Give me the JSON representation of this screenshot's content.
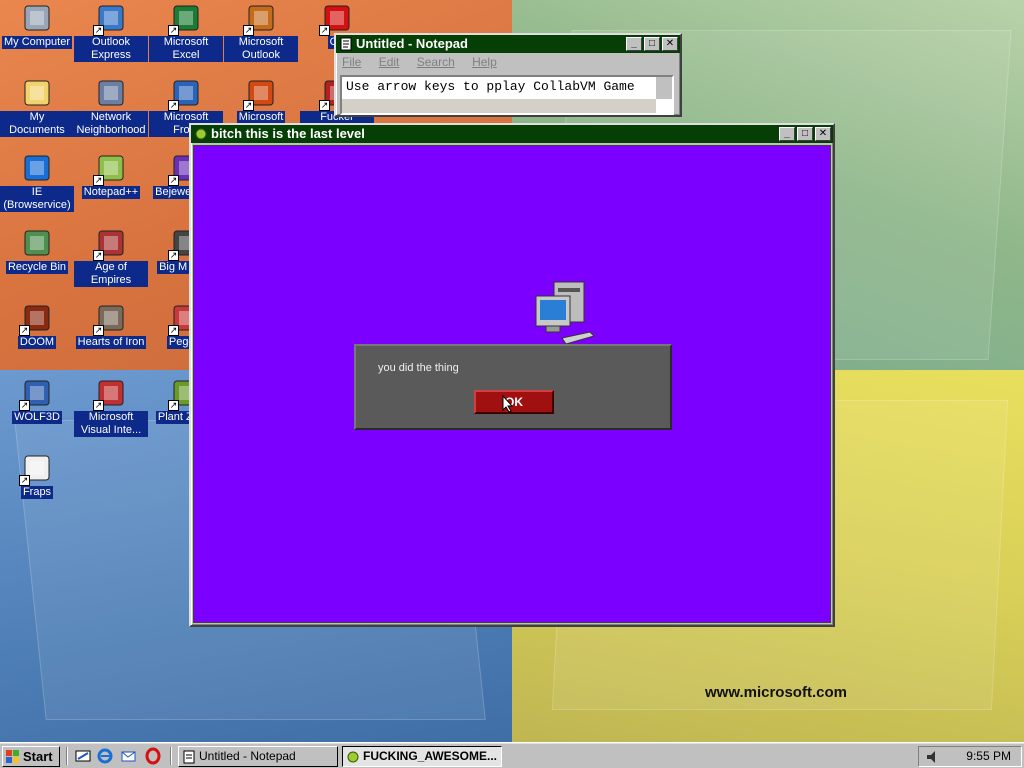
{
  "desktop": {
    "icons": [
      {
        "label": "My Computer",
        "glyph": "computer-icon"
      },
      {
        "label": "Outlook Express",
        "glyph": "outlook-express-icon"
      },
      {
        "label": "Microsoft Excel",
        "glyph": "excel-icon"
      },
      {
        "label": "Microsoft Outlook",
        "glyph": "outlook-icon"
      },
      {
        "label": "Op",
        "glyph": "opera-icon"
      },
      {
        "label": "My Documents",
        "glyph": "documents-folder-icon"
      },
      {
        "label": "Network Neighborhood",
        "glyph": "network-icon"
      },
      {
        "label": "Microsoft Front",
        "glyph": "frontpage-icon"
      },
      {
        "label": "Microsoft",
        "glyph": "powerpoint-icon"
      },
      {
        "label": "Fucker Google",
        "glyph": "app-icon"
      },
      {
        "label": "IE (Browservice)",
        "glyph": "ie-icon"
      },
      {
        "label": "Notepad++",
        "glyph": "notepadpp-icon"
      },
      {
        "label": "Bejewe Delu",
        "glyph": "gem-icon"
      },
      {
        "label": "Recycle Bin",
        "glyph": "recycle-bin-icon"
      },
      {
        "label": "Age of Empires",
        "glyph": "castle-icon"
      },
      {
        "label": "Big M Delu",
        "glyph": "game-icon"
      },
      {
        "label": "DOOM",
        "glyph": "doom-icon"
      },
      {
        "label": "Hearts of Iron",
        "glyph": "hoi-icon"
      },
      {
        "label": "Peggle",
        "glyph": "peggle-icon"
      },
      {
        "label": "WOLF3D",
        "glyph": "wolf3d-icon"
      },
      {
        "label": "Microsoft Visual Inte...",
        "glyph": "interdev-icon"
      },
      {
        "label": "Plant Zomb",
        "glyph": "plant-icon"
      },
      {
        "label": "Fraps",
        "glyph": "fraps-icon"
      }
    ],
    "wallpaper_url_text": "www.microsoft.com"
  },
  "notepad": {
    "title": "Untitled - Notepad",
    "menu": [
      "File",
      "Edit",
      "Search",
      "Help"
    ],
    "content": "Use arrow keys to pplay CollabVM Game"
  },
  "game_window": {
    "title": "bitch this is the last level",
    "dialog": {
      "message": "you did the thing",
      "ok_label": "OK"
    },
    "background_color": "#7c00ff"
  },
  "window_buttons": {
    "minimize": "_",
    "maximize": "□",
    "close": "✕"
  },
  "taskbar": {
    "start_label": "Start",
    "quick_launch": [
      "show-desktop-icon",
      "ie-icon",
      "outlook-express-icon",
      "opera-icon"
    ],
    "tasks": [
      {
        "label": "Untitled - Notepad",
        "active": false
      },
      {
        "label": "FUCKING_AWESOME...",
        "active": true
      }
    ],
    "clock": "9:55 PM"
  },
  "colors": {
    "title_bar": "#053f05",
    "icon_label_bg": "#0d2a8a",
    "dialog_ok": "#a01010"
  }
}
